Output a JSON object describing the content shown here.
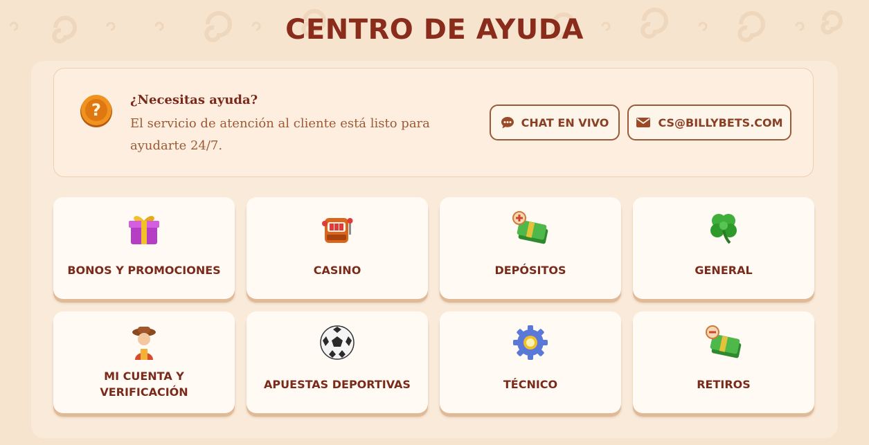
{
  "page": {
    "title": "CENTRO DE AYUDA"
  },
  "help": {
    "title": "¿Necesitas ayuda?",
    "text": "El servicio de atención al cliente está listo para ayudarte 24/7.",
    "chat_label": "CHAT EN VIVO",
    "email_label": "CS@BILLYBETS.COM"
  },
  "categories": [
    {
      "label": "BONOS Y PROMOCIONES",
      "icon": "gift-icon"
    },
    {
      "label": "CASINO",
      "icon": "slot-machine-icon"
    },
    {
      "label": "DEPÓSITOS",
      "icon": "money-plus-icon"
    },
    {
      "label": "GENERAL",
      "icon": "clover-icon"
    },
    {
      "label": "MI CUENTA Y VERIFICACIÓN",
      "icon": "cowboy-avatar-icon"
    },
    {
      "label": "APUESTAS DEPORTIVAS",
      "icon": "soccer-ball-icon"
    },
    {
      "label": "TÉCNICO",
      "icon": "gear-icon"
    },
    {
      "label": "RETIROS",
      "icon": "money-minus-icon"
    }
  ],
  "colors": {
    "title": "#8a2c1c",
    "accent": "#9a5a36",
    "background": "#f6e4cf"
  }
}
